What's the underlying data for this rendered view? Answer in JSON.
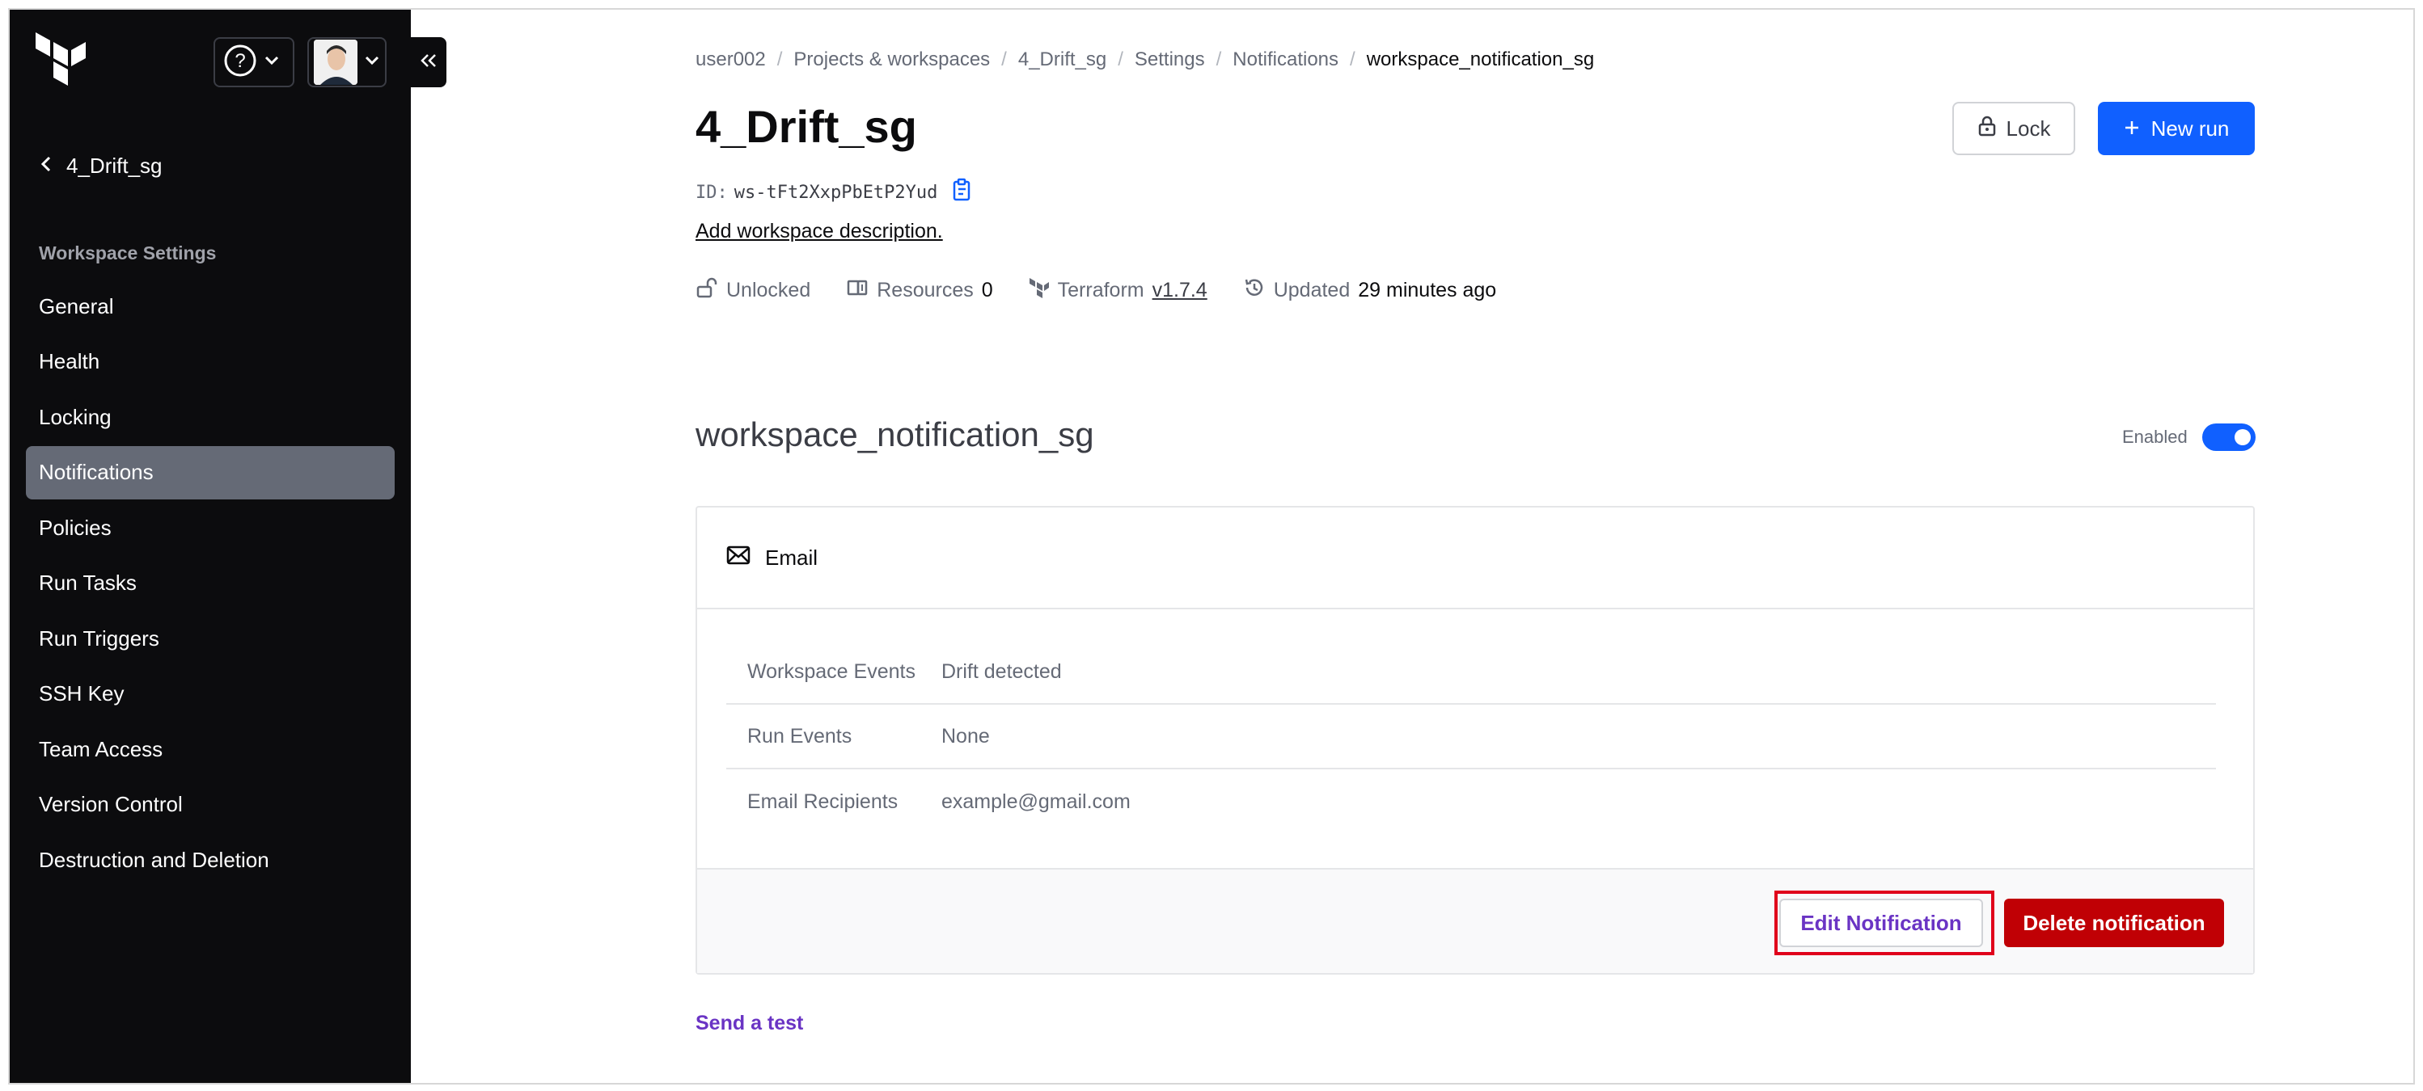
{
  "colors": {
    "sidebar_bg": "#0c0c0e",
    "active_nav_bg": "#656a76",
    "primary_blue": "#1060ff",
    "danger_red": "#c00005",
    "purple_link": "#6a34c4",
    "highlight_red": "#e0001b"
  },
  "sidebar": {
    "logo_icon": "terraform-logo",
    "help_icon": "question-circle-icon",
    "user_icon": "user-avatar",
    "back_label": "4_Drift_sg",
    "section_title": "Workspace Settings",
    "items": [
      {
        "label": "General"
      },
      {
        "label": "Health"
      },
      {
        "label": "Locking"
      },
      {
        "label": "Notifications",
        "active": true
      },
      {
        "label": "Policies"
      },
      {
        "label": "Run Tasks"
      },
      {
        "label": "Run Triggers"
      },
      {
        "label": "SSH Key"
      },
      {
        "label": "Team Access"
      },
      {
        "label": "Version Control"
      },
      {
        "label": "Destruction and Deletion"
      }
    ]
  },
  "breadcrumb": {
    "items": [
      "user002",
      "Projects & workspaces",
      "4_Drift_sg",
      "Settings",
      "Notifications"
    ],
    "current": "workspace_notification_sg"
  },
  "workspace": {
    "title": "4_Drift_sg",
    "id_label": "ID:",
    "id_value": "ws-tFt2XxpPbEtP2Yud",
    "add_description": "Add workspace description.",
    "meta": {
      "lock_status": "Unlocked",
      "resources_label": "Resources",
      "resources_value": "0",
      "terraform_label": "Terraform",
      "terraform_version": "v1.7.4",
      "updated_label": "Updated",
      "updated_value": "29 minutes ago"
    },
    "lock_button": "Lock",
    "new_run_button": "New run"
  },
  "notification": {
    "title": "workspace_notification_sg",
    "enabled_label": "Enabled",
    "enabled": true,
    "type": "Email",
    "rows": [
      {
        "key": "Workspace Events",
        "value": "Drift detected"
      },
      {
        "key": "Run Events",
        "value": "None"
      },
      {
        "key": "Email Recipients",
        "value": "example@gmail.com"
      }
    ],
    "edit_button": "Edit Notification",
    "delete_button": "Delete notification",
    "send_test": "Send a test"
  }
}
